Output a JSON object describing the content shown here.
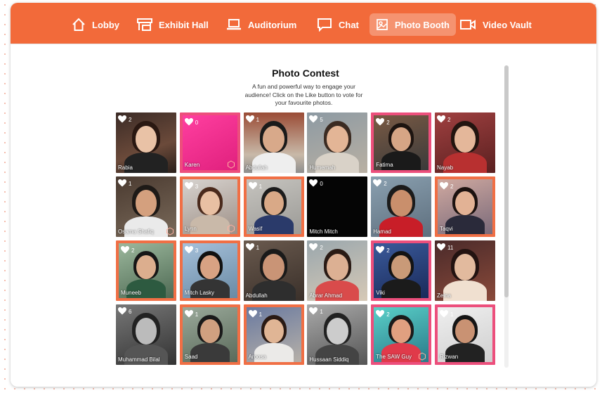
{
  "nav": {
    "items": [
      {
        "label": "Lobby",
        "icon": "home-icon"
      },
      {
        "label": "Exhibit Hall",
        "icon": "booth-icon"
      },
      {
        "label": "Auditorium",
        "icon": "laptop-icon"
      },
      {
        "label": "Chat",
        "icon": "chat-bubble-icon"
      },
      {
        "label": "Photo Booth",
        "icon": "photo-icon",
        "active": true
      },
      {
        "label": "Video Vault",
        "icon": "video-camera-icon"
      }
    ],
    "accent": "#f26a3a"
  },
  "contest": {
    "title": "Photo Contest",
    "subtitle": "A fun and powerful way to engage your audience! Click on the Like button to vote for your favourite photos."
  },
  "photos": [
    {
      "name": "Rabia",
      "likes": "2"
    },
    {
      "name": "Karen",
      "likes": "0"
    },
    {
      "name": "Abdullah",
      "likes": "1"
    },
    {
      "name": "Humemah",
      "likes": "5"
    },
    {
      "name": "Fatima",
      "likes": "2"
    },
    {
      "name": "Nayab",
      "likes": "2"
    },
    {
      "name": "Osama Shafiq",
      "likes": "1"
    },
    {
      "name": "Lynn",
      "likes": "3"
    },
    {
      "name": "Wasif",
      "likes": "1"
    },
    {
      "name": "Mitch Mitch",
      "likes": "0"
    },
    {
      "name": "Hamad",
      "likes": "2"
    },
    {
      "name": "Taqvi",
      "likes": "2"
    },
    {
      "name": "Muneeb",
      "likes": "2"
    },
    {
      "name": "Mitch Lasky",
      "likes": "3"
    },
    {
      "name": "Abdullah",
      "likes": "1"
    },
    {
      "name": "Abrar Ahmad",
      "likes": "2"
    },
    {
      "name": "Viki",
      "likes": "2"
    },
    {
      "name": "Zeina",
      "likes": "11"
    },
    {
      "name": "Muhammad Bilal",
      "likes": "6"
    },
    {
      "name": "Saad",
      "likes": "1"
    },
    {
      "name": "Aroosa",
      "likes": "1"
    },
    {
      "name": "Hussaan Siddiq",
      "likes": "1"
    },
    {
      "name": "The SAW Guy",
      "likes": "2"
    },
    {
      "name": "Rizwan",
      "likes": "1"
    }
  ]
}
